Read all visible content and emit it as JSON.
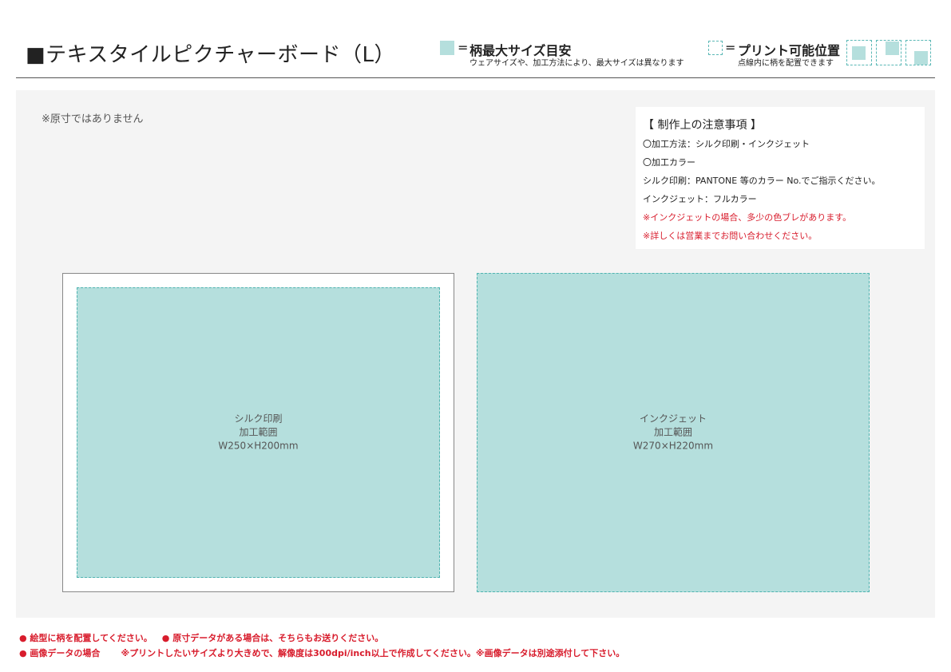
{
  "header": {
    "title": "■テキスタイルピクチャーボード（L）"
  },
  "legend": {
    "max_size": {
      "equals": "=",
      "title": "柄最大サイズ目安",
      "subtitle": "ウェアサイズや、加工方法により、最大サイズは異なります"
    },
    "print_position": {
      "equals": "=",
      "title": "プリント可能位置",
      "subtitle": "点線内に柄を配置できます"
    }
  },
  "canvas": {
    "scale_note": "※原寸ではありません"
  },
  "notes": {
    "title": "【 制作上の注意事項 】",
    "lines": [
      "〇加工方法：シルク印刷・インクジェット",
      "〇加工カラー",
      "シルク印刷：PANTONE 等のカラー No.でご指示ください。",
      "インクジェット：フルカラー"
    ],
    "warnings": [
      "※インクジェットの場合、多少の色ブレがあります。",
      "※詳しくは営業までお問い合わせください。"
    ]
  },
  "areas": {
    "silk": {
      "method": "シルク印刷",
      "label": "加工範囲",
      "size": "W250×H200mm"
    },
    "inkjet": {
      "method": "インクジェット",
      "label": "加工範囲",
      "size": "W270×H220mm"
    }
  },
  "footer": {
    "item1": "● 絵型に柄を配置してください。",
    "item2": "● 原寸データがある場合は、そちらもお送りください。",
    "item3": "● 画像データの場合",
    "item4": "※プリントしたいサイズより大きめで、解像度は300dpi/inch以上で作成してください。※画像データは別途添付して下さい。"
  },
  "colors": {
    "area_fill": "#b5dfdd",
    "area_border": "#4fb3b0",
    "warning_red": "#d81c2c",
    "canvas_bg": "#f4f4f4"
  }
}
